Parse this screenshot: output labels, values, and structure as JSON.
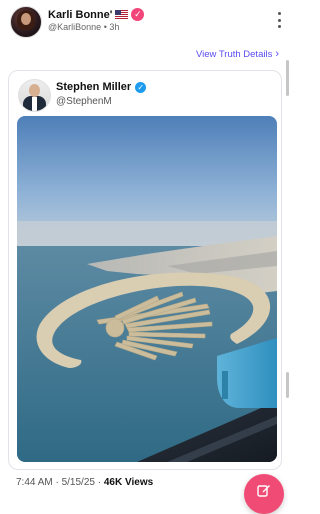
{
  "post": {
    "author_name": "Karli Bonne'",
    "handle": "@KarliBonne",
    "separator": "•",
    "time": "3h",
    "avatar_caption": "Karli Bonne'",
    "view_details_label": "View Truth Details",
    "icons": {
      "flag": "us-flag-icon",
      "verified": "verified-badge-icon",
      "more": "more-vertical-icon",
      "chevron": "chevron-right-icon"
    },
    "colors": {
      "accent": "#5a4cf0",
      "verified": "#f2457a"
    }
  },
  "quoted": {
    "name": "Stephen Miller",
    "handle": "@StephenM",
    "image_description": "Aerial view from airplane window of Palm Jumeirah island in Dubai",
    "colors": {
      "verified": "#1d9bf0"
    }
  },
  "footer": {
    "time": "7:44 AM",
    "sep1": " · ",
    "date": "5/15/25",
    "sep2": " · ",
    "views_count": "46K",
    "views_label": " Views"
  },
  "fab": {
    "icon": "compose-icon",
    "color": "#f04b74"
  }
}
